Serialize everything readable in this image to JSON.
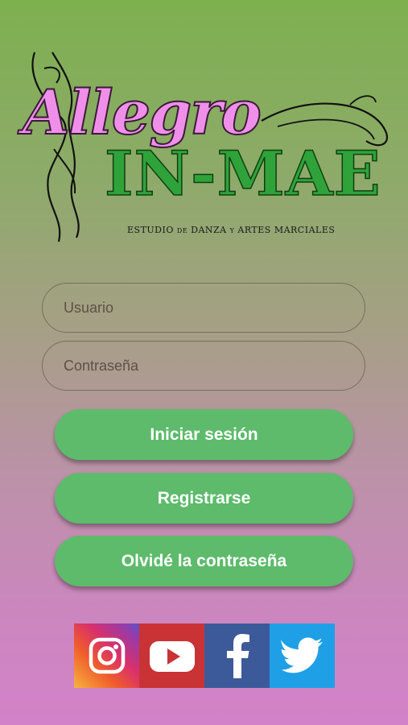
{
  "logo": {
    "line1": "Allegro",
    "line2": "IN-MAE",
    "tagline_parts": [
      "ESTUDIO",
      "DE",
      "DANZA",
      "Y",
      "ARTES MARCIALES"
    ]
  },
  "form": {
    "username_placeholder": "Usuario",
    "password_placeholder": "Contraseña"
  },
  "buttons": {
    "login": "Iniciar sesión",
    "register": "Registrarse",
    "forgot": "Olvidé la contraseña"
  },
  "social": [
    {
      "name": "instagram-icon",
      "color": "#d9306b"
    },
    {
      "name": "youtube-icon",
      "color": "#c93335"
    },
    {
      "name": "facebook-icon",
      "color": "#3c5a9a"
    },
    {
      "name": "twitter-icon",
      "color": "#1fa0e6"
    }
  ],
  "colors": {
    "accent_green": "#5dbb6b",
    "logo_pink": "#f08fe9",
    "logo_green": "#2fa33a"
  }
}
